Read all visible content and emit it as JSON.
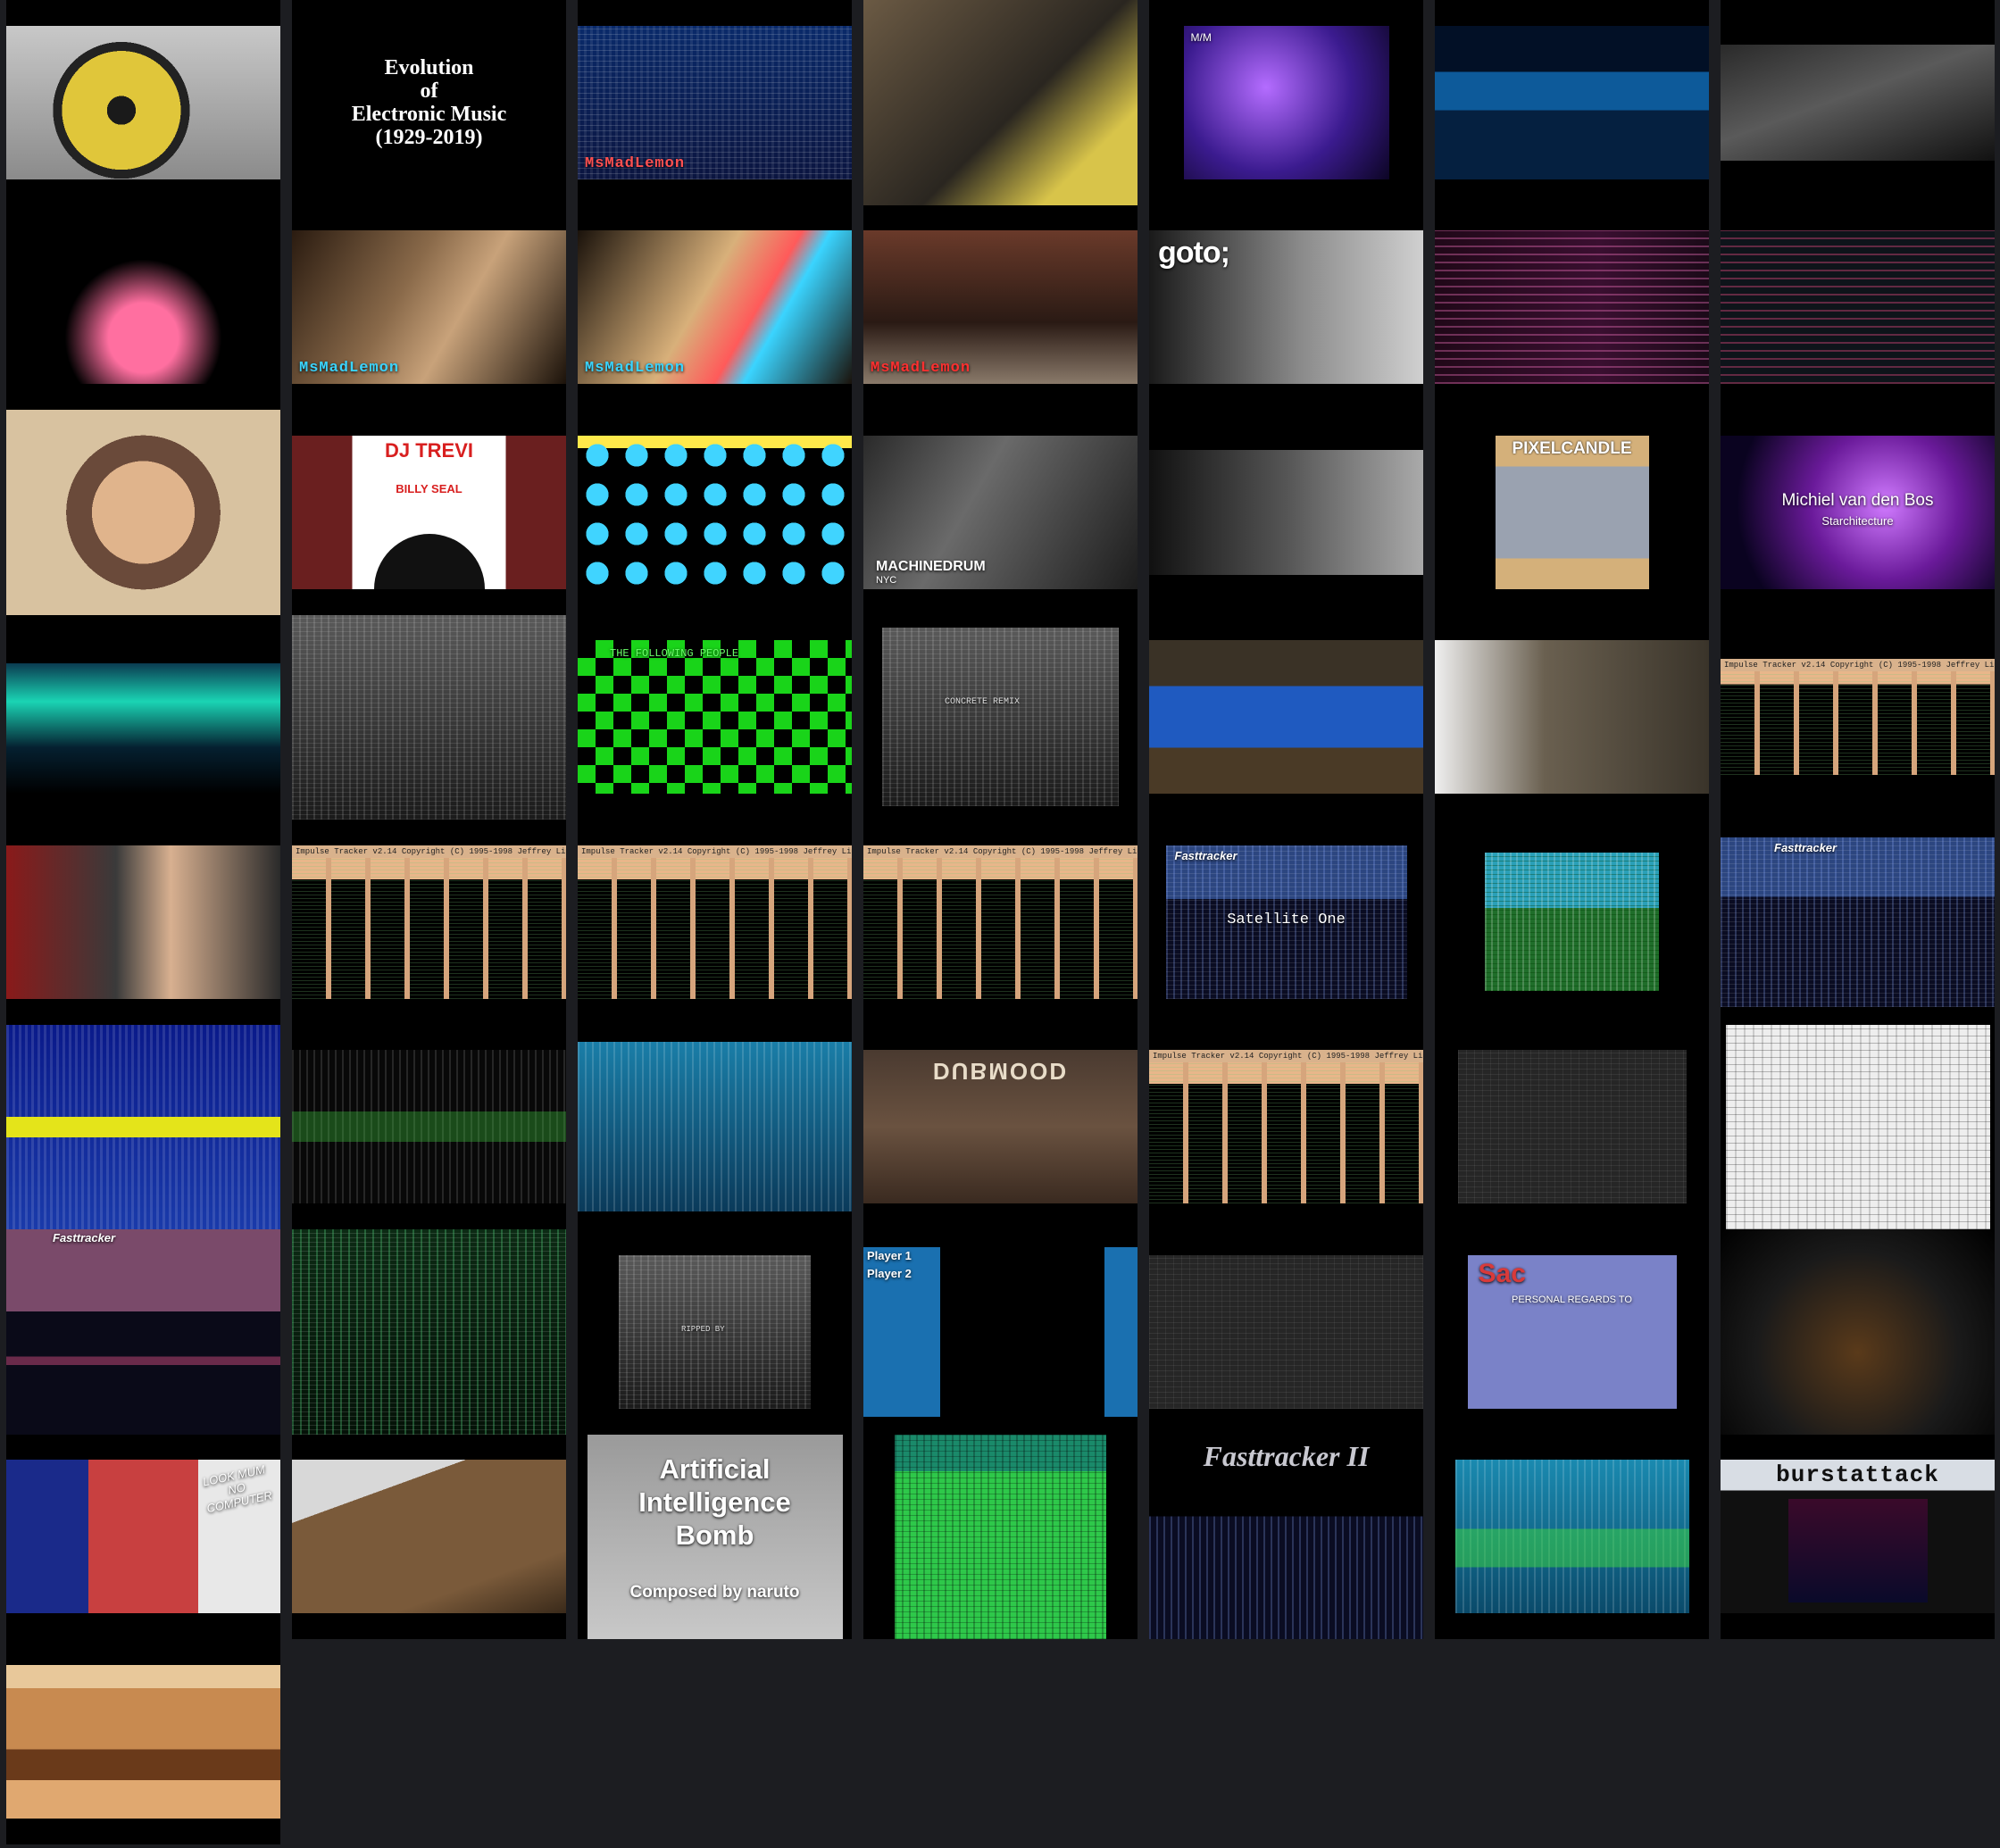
{
  "gallery": {
    "items": [
      {
        "id": "turntable",
        "caption": ""
      },
      {
        "id": "evolution-title",
        "caption": "Evolution\nof\nElectronic Music\n(1929-2019)"
      },
      {
        "id": "msmadlemon-tracker",
        "caption": "MsMadLemon"
      },
      {
        "id": "studio-overhead",
        "caption": ""
      },
      {
        "id": "mm-performer",
        "caption": "M/M"
      },
      {
        "id": "concert-crowd",
        "caption": ""
      },
      {
        "id": "bass-guitar",
        "caption": ""
      },
      {
        "id": "blue-man-group",
        "caption": ""
      },
      {
        "id": "msmadlemon-chip-1",
        "caption": "MsMadLemon"
      },
      {
        "id": "msmadlemon-chip-2",
        "caption": "MsMadLemon"
      },
      {
        "id": "msmadlemon-cat-boombox",
        "caption": "MsMadLemon"
      },
      {
        "id": "goto-talk",
        "caption": "goto;"
      },
      {
        "id": "live-coding-pink",
        "caption": ""
      },
      {
        "id": "live-coding-editor",
        "caption": ""
      },
      {
        "id": "gameboy-guy",
        "caption": ""
      },
      {
        "id": "dj-trevi",
        "caption": "DJ TREVI",
        "subcaption": "BILLY SEAL"
      },
      {
        "id": "blue-faces",
        "caption": ""
      },
      {
        "id": "machinedrum",
        "caption": "MACHINEDRUM",
        "subcaption": "NYC"
      },
      {
        "id": "keytar-bw",
        "caption": ""
      },
      {
        "id": "pixelcandle",
        "caption": "PIXELCANDLE"
      },
      {
        "id": "michiel-van-den-bos",
        "caption": "Michiel van den Bos",
        "subcaption": "Starchitecture"
      },
      {
        "id": "aurora-lake",
        "caption": ""
      },
      {
        "id": "tracker-grey-1",
        "caption": ""
      },
      {
        "id": "following-people",
        "caption": "THE FOLLOWING PEOPLE"
      },
      {
        "id": "concrete-remix",
        "caption": "CONCRETE REMIX"
      },
      {
        "id": "barrels-drummer",
        "caption": ""
      },
      {
        "id": "skeleton-room",
        "caption": ""
      },
      {
        "id": "impulse-tracker-1",
        "caption": "Impulse Tracker v2.14 Copyright (C) 1995-1998 Jeffrey Lim"
      },
      {
        "id": "man-studio",
        "caption": ""
      },
      {
        "id": "impulse-tracker-2",
        "caption": "Impulse Tracker v2.14 Copyright (C) 1995-1998 Jeffrey Lim"
      },
      {
        "id": "impulse-tracker-3",
        "caption": "Impulse Tracker v2.14 Copyright (C) 1995-1998 Jeffrey Lim"
      },
      {
        "id": "impulse-tracker-4",
        "caption": "Impulse Tracker v2.14 Copyright (C) 1995-1998 Jeffrey Lim"
      },
      {
        "id": "satellite-one",
        "caption": "Fasttracker",
        "subcaption": "Satellite One"
      },
      {
        "id": "tracker-small-1",
        "caption": ""
      },
      {
        "id": "fasttracker-2",
        "caption": "Fasttracker"
      },
      {
        "id": "blue-tracker",
        "caption": ""
      },
      {
        "id": "tracker-dark-green",
        "caption": ""
      },
      {
        "id": "fasttracker-config",
        "caption": ""
      },
      {
        "id": "dubmood",
        "caption": "DUBMOOD"
      },
      {
        "id": "impulse-tracker-5",
        "caption": "Impulse Tracker v2.14 Copyright (C) 1995-1998 Jeffrey Lim"
      },
      {
        "id": "tracker-dark-ui",
        "caption": ""
      },
      {
        "id": "famitracker-white",
        "caption": ""
      },
      {
        "id": "fasttracker-3",
        "caption": "Fasttracker"
      },
      {
        "id": "tracker-green-2",
        "caption": ""
      },
      {
        "id": "tracker-grey-2",
        "caption": "RIPPED BY"
      },
      {
        "id": "player-tracker",
        "caption": "Player 1",
        "subcaption": "Player 2"
      },
      {
        "id": "tracker-dark-lines",
        "caption": ""
      },
      {
        "id": "sac-credits",
        "caption": "Sac",
        "subcaption": "PERSONAL REGARDS TO"
      },
      {
        "id": "robot-arm",
        "caption": ""
      },
      {
        "id": "organ-player",
        "caption": "LOOK MUM NO COMPUTER"
      },
      {
        "id": "car-interior",
        "caption": ""
      },
      {
        "id": "ai-bomb",
        "caption": "Artificial\nIntelligence\nBomb",
        "subcaption": "Composed by naruto"
      },
      {
        "id": "tracker-teal-green",
        "caption": ""
      },
      {
        "id": "fasttracker-logo",
        "caption": "Fasttracker II"
      },
      {
        "id": "tracker-teal-wide",
        "caption": ""
      },
      {
        "id": "burstattack",
        "caption": "burstattack"
      },
      {
        "id": "desert-dunes",
        "caption": ""
      }
    ]
  },
  "colors": {
    "page_background": "#1c1d21",
    "tile_background": "#000000",
    "lemon_accent": "#ff5050"
  }
}
